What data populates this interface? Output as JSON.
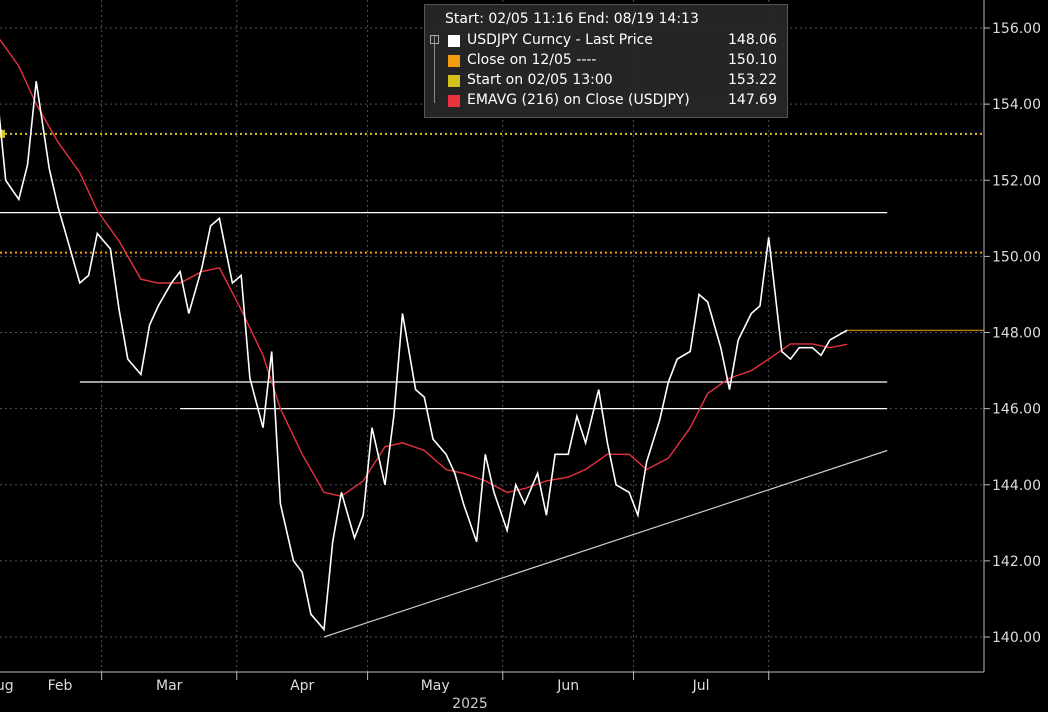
{
  "chart_data": {
    "type": "line",
    "title": "",
    "xlabel": "2025",
    "ylabel": "",
    "ylim": [
      139.5,
      157
    ],
    "yticks": [
      "140.00",
      "142.00",
      "144.00",
      "146.00",
      "148.00",
      "150.00",
      "152.00",
      "154.00",
      "156.00"
    ],
    "month_labels": [
      "Feb",
      "Mar",
      "Apr",
      "May",
      "Jun",
      "Jul",
      "Aug"
    ],
    "year_label": "2025",
    "legend": {
      "header": "Start: 02/05 11:16 End: 08/19 14:13",
      "entries": [
        {
          "label": "USDJPY Curncy - Last Price",
          "value": "148.06",
          "color": "#ffffff"
        },
        {
          "label": "Close on 12/05 ----",
          "value": "150.10",
          "color": "#f39c12"
        },
        {
          "label": "Start on 02/05 13:00",
          "value": "153.22",
          "color": "#d4c21a"
        },
        {
          "label": "EMAVG (216)  on Close (USDJPY)",
          "value": "147.69",
          "color": "#e8303f"
        }
      ]
    },
    "series": [
      {
        "name": "USDJPY Curncy - Last Price",
        "color": "#ffffff",
        "x": [
          "02/05",
          "02/07",
          "02/10",
          "02/12",
          "02/14",
          "02/17",
          "02/19",
          "02/21",
          "02/24",
          "02/26",
          "02/28",
          "03/03",
          "03/05",
          "03/07",
          "03/10",
          "03/12",
          "03/14",
          "03/17",
          "03/19",
          "03/21",
          "03/24",
          "03/26",
          "03/28",
          "03/31",
          "04/02",
          "04/04",
          "04/07",
          "04/09",
          "04/11",
          "04/14",
          "04/16",
          "04/18",
          "04/21",
          "04/23",
          "04/25",
          "04/28",
          "04/30",
          "05/02",
          "05/05",
          "05/07",
          "05/09",
          "05/12",
          "05/14",
          "05/16",
          "05/19",
          "05/21",
          "05/23",
          "05/26",
          "05/28",
          "05/30",
          "06/02",
          "06/04",
          "06/06",
          "06/09",
          "06/11",
          "06/13",
          "06/16",
          "06/18",
          "06/20",
          "06/23",
          "06/25",
          "06/27",
          "06/30",
          "07/02",
          "07/04",
          "07/07",
          "07/09",
          "07/11",
          "07/14",
          "07/16",
          "07/18",
          "07/21",
          "07/23",
          "07/25",
          "07/28",
          "07/30",
          "08/01",
          "08/04",
          "08/06",
          "08/08",
          "08/11",
          "08/13",
          "08/15",
          "08/19"
        ],
        "values": [
          154.3,
          152.0,
          151.5,
          152.4,
          154.6,
          152.3,
          151.3,
          150.5,
          149.3,
          149.5,
          150.6,
          150.2,
          148.6,
          147.3,
          146.9,
          148.2,
          148.7,
          149.3,
          149.6,
          148.5,
          149.7,
          150.8,
          151.0,
          149.3,
          149.5,
          146.8,
          145.5,
          147.5,
          143.5,
          142.0,
          141.7,
          140.6,
          140.2,
          142.5,
          143.8,
          142.6,
          143.2,
          145.5,
          144.0,
          145.8,
          148.5,
          146.5,
          146.3,
          145.2,
          144.8,
          144.3,
          143.5,
          142.5,
          144.8,
          143.8,
          142.8,
          144.0,
          143.5,
          144.3,
          143.2,
          144.8,
          144.8,
          145.8,
          145.1,
          146.5,
          145.1,
          144.0,
          143.8,
          143.2,
          144.6,
          145.7,
          146.7,
          147.3,
          147.5,
          149.0,
          148.8,
          147.6,
          146.5,
          147.8,
          148.5,
          148.7,
          150.5,
          147.5,
          147.3,
          147.6,
          147.6,
          147.4,
          147.8,
          148.06
        ]
      },
      {
        "name": "EMAVG (216)  on Close (USDJPY)",
        "color": "#e8303f",
        "x": [
          "02/05",
          "02/10",
          "02/14",
          "02/19",
          "02/24",
          "02/28",
          "03/05",
          "03/10",
          "03/14",
          "03/19",
          "03/24",
          "03/28",
          "04/02",
          "04/07",
          "04/11",
          "04/16",
          "04/21",
          "04/25",
          "04/30",
          "05/05",
          "05/09",
          "05/14",
          "05/19",
          "05/23",
          "05/28",
          "06/02",
          "06/06",
          "06/11",
          "06/16",
          "06/20",
          "06/25",
          "06/30",
          "07/04",
          "07/09",
          "07/14",
          "07/18",
          "07/23",
          "07/28",
          "08/01",
          "08/06",
          "08/11",
          "08/15",
          "08/19"
        ],
        "values": [
          155.8,
          155.0,
          154.0,
          153.0,
          152.2,
          151.2,
          150.4,
          149.4,
          149.3,
          149.3,
          149.6,
          149.7,
          148.6,
          147.4,
          146.0,
          144.8,
          143.8,
          143.7,
          144.1,
          145.0,
          145.1,
          144.9,
          144.4,
          144.3,
          144.1,
          143.8,
          143.9,
          144.1,
          144.2,
          144.4,
          144.8,
          144.8,
          144.4,
          144.7,
          145.5,
          146.4,
          146.8,
          147.0,
          147.3,
          147.7,
          147.7,
          147.6,
          147.69
        ]
      }
    ],
    "reference_lines": [
      {
        "name": "Close on 12/05 ----",
        "value": 150.1,
        "color": "#f39c12",
        "style": "dotted"
      },
      {
        "name": "Start on 02/05 13:00",
        "value": 153.22,
        "color": "#d4c21a",
        "style": "dotted"
      },
      {
        "value": 148.06,
        "color": "#f39c12",
        "style": "solid"
      }
    ],
    "drawn_lines": [
      {
        "from": [
          "02/05",
          151.15
        ],
        "to": [
          "08/19",
          151.15
        ],
        "color": "#ffffff"
      },
      {
        "from": [
          "02/24",
          146.7
        ],
        "to": [
          "08/19",
          146.7
        ],
        "color": "#ffffff"
      },
      {
        "from": [
          "03/19",
          146.0
        ],
        "to": [
          "08/19",
          146.0
        ],
        "color": "#ffffff"
      },
      {
        "from": [
          "04/21",
          140.0
        ],
        "to": [
          "08/19",
          144.7
        ],
        "color": "#cccccc"
      }
    ]
  }
}
